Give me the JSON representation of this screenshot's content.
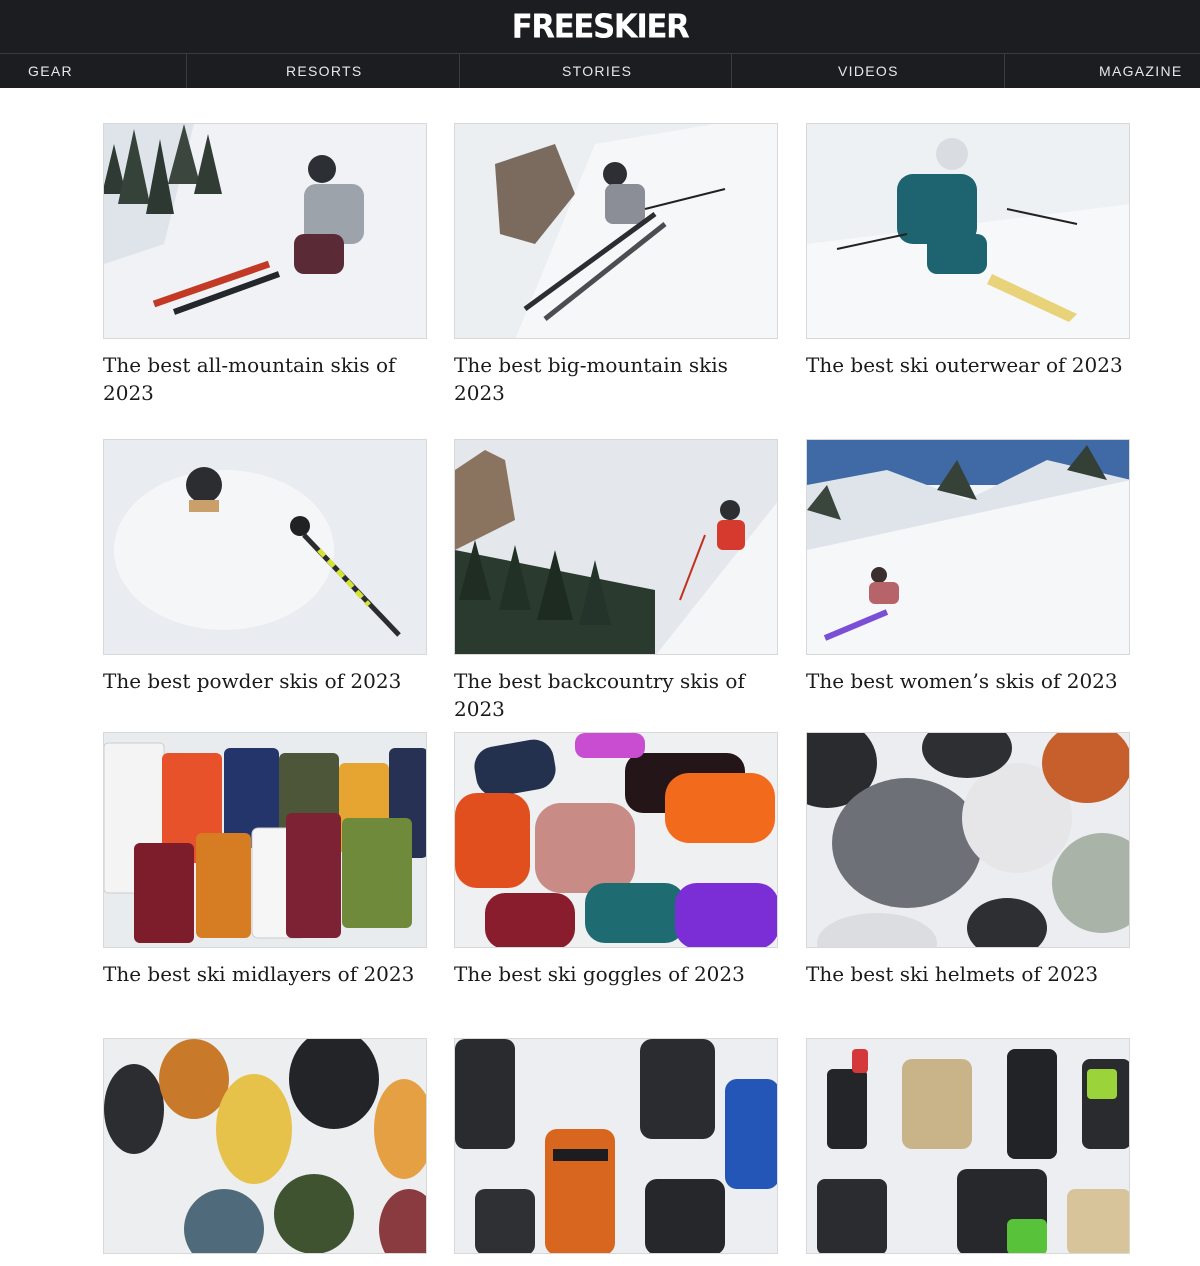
{
  "site": {
    "logo": "FREESKIER"
  },
  "nav": [
    {
      "label": "GEAR"
    },
    {
      "label": "RESORTS"
    },
    {
      "label": "STORIES"
    },
    {
      "label": "VIDEOS"
    },
    {
      "label": "MAGAZINE"
    }
  ],
  "articles": [
    {
      "title": "The best all-mountain skis of 2023"
    },
    {
      "title": "The best big-mountain skis 2023"
    },
    {
      "title": "The best ski outerwear of 2023"
    },
    {
      "title": "The best powder skis of 2023"
    },
    {
      "title": "The best backcountry skis of 2023"
    },
    {
      "title": "The best women’s skis of 2023"
    },
    {
      "title": "The best ski midlayers of 2023"
    },
    {
      "title": "The best ski goggles of 2023"
    },
    {
      "title": "The best ski helmets of 2023"
    },
    {
      "title": ""
    },
    {
      "title": ""
    },
    {
      "title": ""
    }
  ],
  "colors": {
    "header_bg": "#1c1d21",
    "nav_text": "#e8e8e8",
    "title_text": "#1a1a1a",
    "snow": "#eef1f4"
  }
}
